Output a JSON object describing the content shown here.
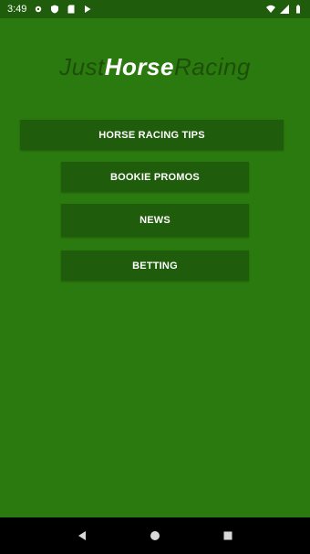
{
  "status_bar": {
    "time": "3:49",
    "left_icons": [
      "gear-icon",
      "shield-icon",
      "sim-card-icon",
      "play-store-icon"
    ],
    "right_icons": [
      "wifi-icon",
      "signal-icon",
      "battery-icon"
    ]
  },
  "logo": {
    "part1": "Just",
    "part2": "Horse",
    "part3": "Racing"
  },
  "menu": {
    "tips_label": "HORSE RACING TIPS",
    "promos_label": "BOOKIE PROMOS",
    "news_label": "NEWS",
    "betting_label": "BETTING"
  },
  "nav": {
    "icons": [
      "back-icon",
      "home-icon",
      "recents-icon"
    ]
  },
  "colors": {
    "background": "#2b7a0f",
    "bar": "#1f5c0b",
    "logo_dark": "#1d4f0a",
    "logo_light": "#ffffff"
  }
}
